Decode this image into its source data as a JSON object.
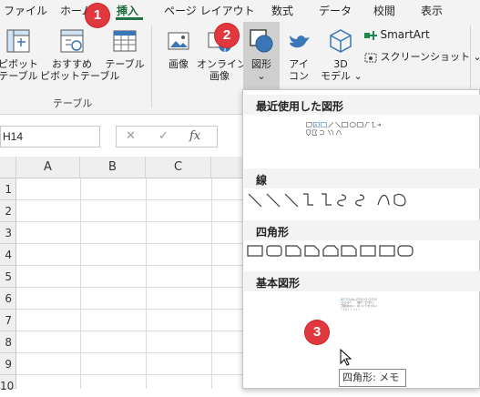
{
  "ribbon_tabs": [
    "ファイル",
    "ホーム",
    "挿入",
    "ページ レイアウト",
    "数式",
    "データ",
    "校閲",
    "表示"
  ],
  "active_tab": "挿入",
  "buttons": {
    "pivot": [
      "ピボット",
      "テーブル"
    ],
    "recommended_pivot": [
      "おすすめ",
      "ピボットテーブル"
    ],
    "table": "テーブル",
    "picture": "画像",
    "online_picture": [
      "オンライン",
      "画像"
    ],
    "shapes": [
      "図形",
      "⌄"
    ],
    "icons": [
      "アイ",
      "コン"
    ],
    "models3d": [
      "3D",
      "モデル ⌄"
    ],
    "smartart": "SmartArt",
    "screenshot": "スクリーンショット ⌄"
  },
  "group_table_label": "テーブル",
  "name_box": "H14",
  "formula_icons": [
    "✕",
    "✓",
    "fx"
  ],
  "columns": [
    "A",
    "B",
    "C"
  ],
  "rows": [
    "1",
    "2",
    "3",
    "4",
    "5",
    "6",
    "7",
    "8",
    "9",
    "10"
  ],
  "badges": [
    "1",
    "2",
    "3"
  ],
  "shapes_menu": {
    "sections": [
      "最近使用した図形",
      "線",
      "四角形",
      "基本図形"
    ]
  },
  "tooltip": "四角形: メモ",
  "colors": {
    "accent": "#217346",
    "badge": "#e0383e",
    "shape_stroke": "#3a3a3a"
  }
}
